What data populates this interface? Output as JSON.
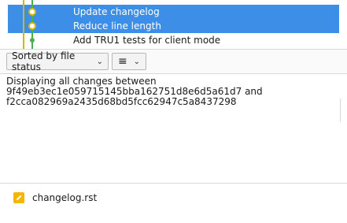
{
  "commits": [
    {
      "message": "Update changelog",
      "selected": true
    },
    {
      "message": "Reduce line length",
      "selected": true
    },
    {
      "message": "Add TRU1 tests for client mode",
      "selected": false
    }
  ],
  "colors": {
    "selection": "#3d8ee6",
    "graph_green": "#4caf50",
    "graph_yellow": "#d4b800",
    "file_icon": "#f7b500"
  },
  "toolbar": {
    "sort_label": "Sorted by file status",
    "sort_chevron_icon": "chevron-down-icon",
    "view_icon": "list-icon",
    "view_chevron_icon": "chevron-down-icon"
  },
  "info": {
    "line1": "Displaying all changes between",
    "line2": "9f49eb3ec1e059715145bba162751d8e6d5a61d7 and",
    "line3": "f2cca082969a2435d68bd5fcc62947c5a8437298"
  },
  "files": [
    {
      "name": "changelog.rst",
      "icon": "modified-file-icon"
    }
  ]
}
